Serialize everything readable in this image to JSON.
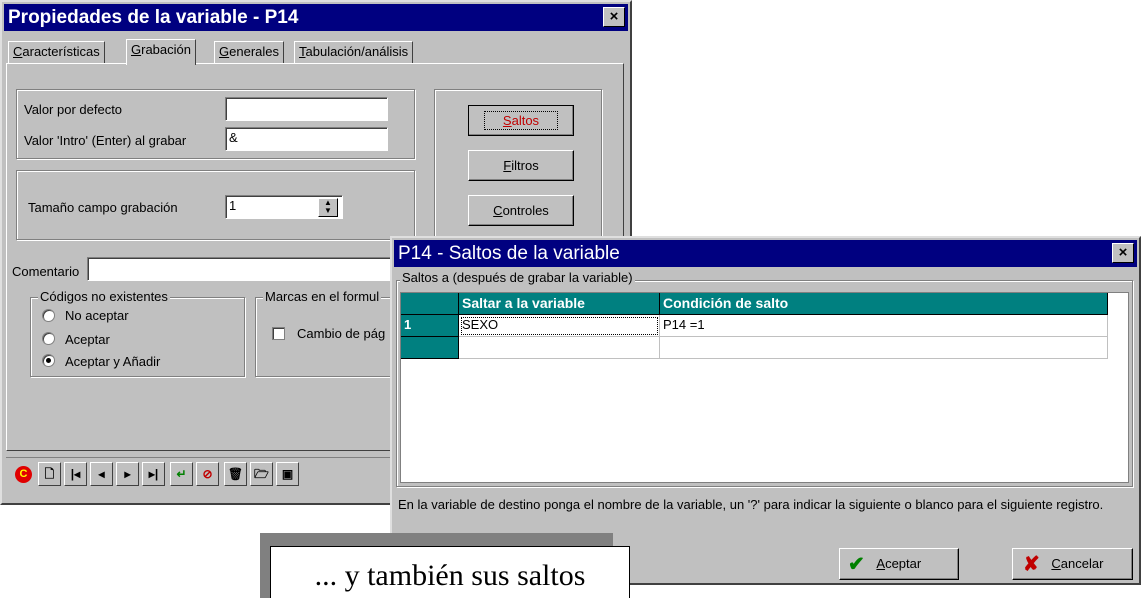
{
  "props_window": {
    "title": "Propiedades de la variable - P14",
    "close_glyph": "×",
    "tabs": [
      {
        "label": "Características",
        "underline": "C",
        "rest": "aracterísticas"
      },
      {
        "label": "Grabación",
        "underline": "G",
        "rest": "rabación"
      },
      {
        "label": "Generales",
        "underline": "G",
        "rest": "enerales"
      },
      {
        "label": "Tabulación/análisis",
        "underline": "T",
        "rest": "abulación/análisis"
      }
    ],
    "valor_defecto_label": "Valor por defecto",
    "valor_defecto_value": "",
    "valor_intro_label": "Valor 'Intro' (Enter) al grabar",
    "valor_intro_value": "&",
    "tamano_label": "Tamaño campo grabación",
    "tamano_value": "1",
    "buttons": {
      "saltos": {
        "underline": "S",
        "rest": "altos"
      },
      "filtros": {
        "underline": "F",
        "rest": "iltros"
      },
      "controles": {
        "underline": "C",
        "rest": "ontroles"
      }
    },
    "comentario_label": "Comentario",
    "comentario_value": "",
    "codigos_group": "Códigos no existentes",
    "codigos_options": [
      "No aceptar",
      "Aceptar",
      "Aceptar y Añadir"
    ],
    "codigos_selected": "Aceptar y Añadir",
    "marcas_group": "Marcas en el formul",
    "cambio_label": "Cambio de pág",
    "toolbar_icons": [
      "c-logo-icon",
      "new-document-icon",
      "first-record-icon",
      "prev-record-icon",
      "next-record-icon",
      "last-record-icon",
      "renumber-icon",
      "no-filter-icon",
      "trash-icon",
      "open-folder-icon",
      "save-disk-icon"
    ]
  },
  "saltos_window": {
    "title": "P14 - Saltos de la variable",
    "close_glyph": "×",
    "group_label": "Saltos a (después de grabar la variable)",
    "columns": [
      "Saltar a la variable",
      "Condición de salto"
    ],
    "rows": [
      {
        "num": "1",
        "variable": "SEXO",
        "condicion": "P14 =1"
      },
      {
        "num": "",
        "variable": "",
        "condicion": ""
      }
    ],
    "help_text": "En la variable de destino ponga el nombre de la variable, un '?' para indicar la siguiente o blanco para el siguiente registro.",
    "aceptar": {
      "underline": "A",
      "rest": "ceptar"
    },
    "cancelar": {
      "underline": "C",
      "rest": "ancelar"
    }
  },
  "caption": "... y también sus saltos",
  "colors": {
    "title_bar": "#000080",
    "grid_header": "#008080",
    "face": "#c0c0c0"
  }
}
